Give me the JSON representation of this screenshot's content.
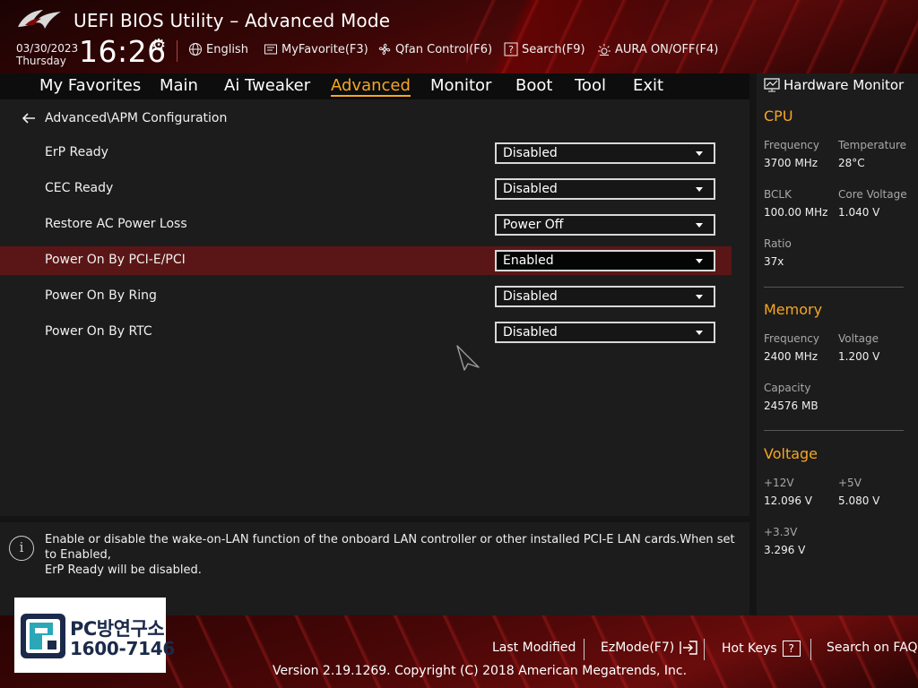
{
  "header": {
    "title": "UEFI BIOS Utility – Advanced Mode",
    "date": "03/30/2023",
    "day": "Thursday",
    "time": "16:26",
    "tools": [
      {
        "label": "English",
        "icon": "globe-icon"
      },
      {
        "label": "MyFavorite(F3)",
        "icon": "favorite-icon"
      },
      {
        "label": "Qfan Control(F6)",
        "icon": "fan-icon"
      },
      {
        "label": "Search(F9)",
        "icon": "search-icon"
      },
      {
        "label": "AURA ON/OFF(F4)",
        "icon": "aura-icon"
      }
    ]
  },
  "menu": {
    "tabs": [
      "My Favorites",
      "Main",
      "Ai Tweaker",
      "Advanced",
      "Monitor",
      "Boot",
      "Tool",
      "Exit"
    ],
    "active": "Advanced"
  },
  "main": {
    "breadcrumb": "Advanced\\APM Configuration",
    "settings": [
      {
        "label": "ErP Ready",
        "value": "Disabled"
      },
      {
        "label": "CEC Ready",
        "value": "Disabled"
      },
      {
        "label": "Restore AC Power Loss",
        "value": "Power Off"
      },
      {
        "label": "Power On By PCI-E/PCI",
        "value": "Enabled"
      },
      {
        "label": "Power On By Ring",
        "value": "Disabled"
      },
      {
        "label": "Power On By RTC",
        "value": "Disabled"
      }
    ],
    "selected_setting": "Power On By PCI-E/PCI"
  },
  "help": {
    "line1": "Enable or disable the wake-on-LAN function of the onboard LAN controller or other installed PCI-E LAN cards.When set to Enabled,",
    "line2": "ErP Ready will be disabled."
  },
  "hardware_monitor": {
    "title": "Hardware Monitor",
    "cpu": {
      "heading": "CPU",
      "frequency_label": "Frequency",
      "frequency": "3700 MHz",
      "temperature_label": "Temperature",
      "temperature": "28°C",
      "bclk_label": "BCLK",
      "bclk": "100.00 MHz",
      "core_voltage_label": "Core Voltage",
      "core_voltage": "1.040 V",
      "ratio_label": "Ratio",
      "ratio": "37x"
    },
    "memory": {
      "heading": "Memory",
      "frequency_label": "Frequency",
      "frequency": "2400 MHz",
      "voltage_label": "Voltage",
      "voltage": "1.200 V",
      "capacity_label": "Capacity",
      "capacity": "24576 MB"
    },
    "voltage": {
      "heading": "Voltage",
      "v12_label": "+12V",
      "v12": "12.096 V",
      "v5_label": "+5V",
      "v5": "5.080 V",
      "v33_label": "+3.3V",
      "v33": "3.296 V"
    }
  },
  "footer": {
    "last_modified": "Last Modified",
    "ezmode": "EzMode(F7)",
    "hot_keys": "Hot Keys",
    "hot_keys_key": "?",
    "search_faq": "Search on FAQ",
    "copyright": "Version 2.19.1269. Copyright (C) 2018 American Megatrends, Inc."
  },
  "watermark": {
    "line1": "PC방연구소",
    "line2": "1600-7146"
  },
  "colors": {
    "accent": "#f6a623",
    "selected_row": "#5a1616",
    "header_red": "#5a0a0a"
  }
}
